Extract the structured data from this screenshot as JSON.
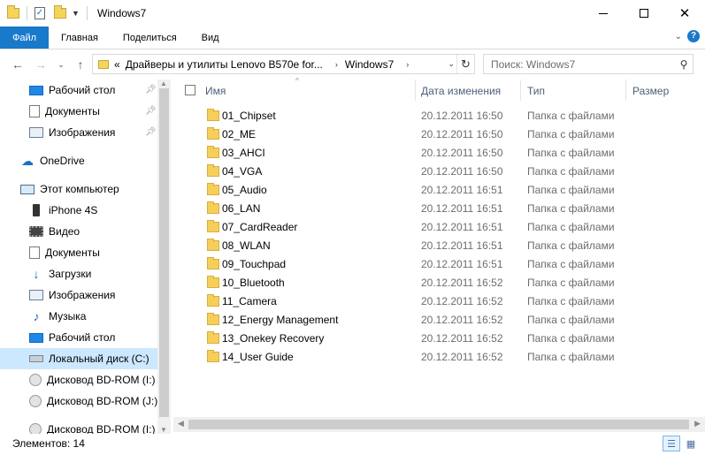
{
  "window": {
    "title": "Windows7"
  },
  "ribbon": {
    "tabs": [
      {
        "label": "Файл",
        "active": true
      },
      {
        "label": "Главная"
      },
      {
        "label": "Поделиться"
      },
      {
        "label": "Вид"
      }
    ]
  },
  "address": {
    "overflow": "«",
    "crumbs": [
      "Драйверы и утилиты Lenovo B570e for...",
      "Windows7"
    ]
  },
  "search": {
    "placeholder": "Поиск: Windows7"
  },
  "nav": {
    "items": [
      {
        "label": "Рабочий стол",
        "icon": "desktop-icon",
        "pinned": true
      },
      {
        "label": "Документы",
        "icon": "documents-icon",
        "pinned": true
      },
      {
        "label": "Изображения",
        "icon": "pictures-icon",
        "pinned": true
      },
      {
        "label": "OneDrive",
        "icon": "onedrive-icon"
      },
      {
        "label": "Этот компьютер",
        "icon": "computer-icon"
      },
      {
        "label": "iPhone 4S",
        "icon": "phone-icon"
      },
      {
        "label": "Видео",
        "icon": "video-icon"
      },
      {
        "label": "Документы",
        "icon": "documents-icon"
      },
      {
        "label": "Загрузки",
        "icon": "downloads-icon"
      },
      {
        "label": "Изображения",
        "icon": "pictures-icon"
      },
      {
        "label": "Музыка",
        "icon": "music-icon"
      },
      {
        "label": "Рабочий стол",
        "icon": "desktop-icon"
      },
      {
        "label": "Локальный диск (C:)",
        "icon": "drive-icon",
        "selected": true
      },
      {
        "label": "Дисковод BD-ROM (I:)",
        "icon": "disc-drive-icon"
      },
      {
        "label": "Дисковод BD-ROM (J:)",
        "icon": "disc-drive-icon"
      },
      {
        "label": "Дисковод BD-ROM (I:) Li",
        "icon": "disc-drive-icon"
      }
    ]
  },
  "columns": {
    "name": "Имя",
    "date": "Дата изменения",
    "type": "Тип",
    "size": "Размер"
  },
  "files": [
    {
      "name": "01_Chipset",
      "date": "20.12.2011 16:50",
      "type": "Папка с файлами"
    },
    {
      "name": "02_ME",
      "date": "20.12.2011 16:50",
      "type": "Папка с файлами"
    },
    {
      "name": "03_AHCI",
      "date": "20.12.2011 16:50",
      "type": "Папка с файлами"
    },
    {
      "name": "04_VGA",
      "date": "20.12.2011 16:50",
      "type": "Папка с файлами"
    },
    {
      "name": "05_Audio",
      "date": "20.12.2011 16:51",
      "type": "Папка с файлами"
    },
    {
      "name": "06_LAN",
      "date": "20.12.2011 16:51",
      "type": "Папка с файлами"
    },
    {
      "name": "07_CardReader",
      "date": "20.12.2011 16:51",
      "type": "Папка с файлами"
    },
    {
      "name": "08_WLAN",
      "date": "20.12.2011 16:51",
      "type": "Папка с файлами"
    },
    {
      "name": "09_Touchpad",
      "date": "20.12.2011 16:51",
      "type": "Папка с файлами"
    },
    {
      "name": "10_Bluetooth",
      "date": "20.12.2011 16:52",
      "type": "Папка с файлами"
    },
    {
      "name": "11_Camera",
      "date": "20.12.2011 16:52",
      "type": "Папка с файлами"
    },
    {
      "name": "12_Energy Management",
      "date": "20.12.2011 16:52",
      "type": "Папка с файлами"
    },
    {
      "name": "13_Onekey Recovery",
      "date": "20.12.2011 16:52",
      "type": "Папка с файлами"
    },
    {
      "name": "14_User Guide",
      "date": "20.12.2011 16:52",
      "type": "Папка с файлами"
    }
  ],
  "status": {
    "count": "Элементов: 14"
  },
  "colors": {
    "accent": "#1979ca",
    "selection": "#cce8ff",
    "folder": "#f5cf5a"
  }
}
